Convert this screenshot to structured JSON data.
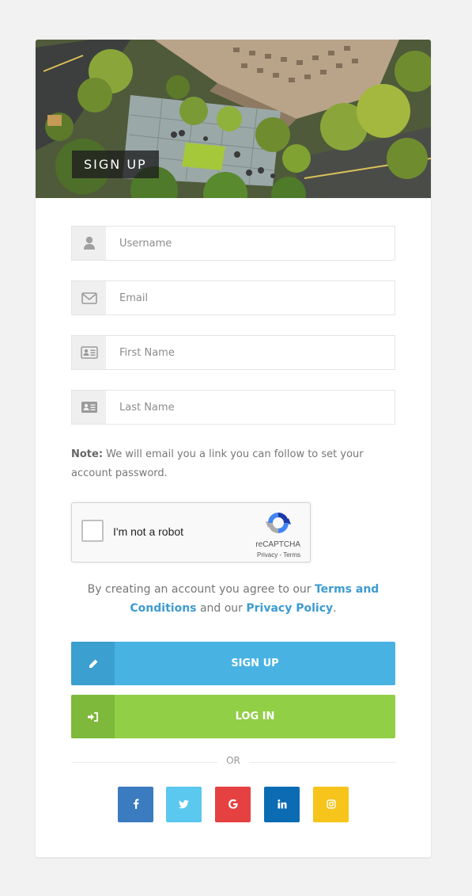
{
  "hero": {
    "title": "SIGN UP"
  },
  "form": {
    "username": {
      "placeholder": "Username",
      "icon": "user-icon"
    },
    "email": {
      "placeholder": "Email",
      "icon": "envelope-icon"
    },
    "first_name": {
      "placeholder": "First Name",
      "icon": "id-card-icon"
    },
    "last_name": {
      "placeholder": "Last Name",
      "icon": "id-card-filled-icon"
    }
  },
  "note": {
    "label": "Note:",
    "text": " We will email you a link you can follow to set your account password."
  },
  "recaptcha": {
    "label": "I'm not a robot",
    "brand": "reCAPTCHA",
    "privacy": "Privacy",
    "separator": " - ",
    "terms": "Terms"
  },
  "agreement": {
    "prefix": "By creating an account you agree to our ",
    "terms_link": "Terms and Conditions",
    "middle": " and our ",
    "privacy_link": "Privacy Policy",
    "suffix": "."
  },
  "buttons": {
    "signup": {
      "label": "SIGN UP",
      "icon": "pencil-icon"
    },
    "login": {
      "label": "LOG IN",
      "icon": "sign-in-icon"
    }
  },
  "divider": {
    "label": "OR"
  },
  "social": [
    {
      "name": "facebook",
      "icon": "facebook-icon",
      "color": "#3b7bbf"
    },
    {
      "name": "twitter",
      "icon": "twitter-icon",
      "color": "#5bc8ef"
    },
    {
      "name": "google",
      "icon": "google-icon",
      "color": "#e64141"
    },
    {
      "name": "linkedin",
      "icon": "linkedin-icon",
      "color": "#0b6cb3"
    },
    {
      "name": "instagram",
      "icon": "instagram-icon",
      "color": "#f6c41b"
    }
  ],
  "colors": {
    "accent_blue": "#48b3e3",
    "accent_green": "#91cf47",
    "link": "#3d9bd2",
    "page_bg": "#f2f2f2"
  }
}
